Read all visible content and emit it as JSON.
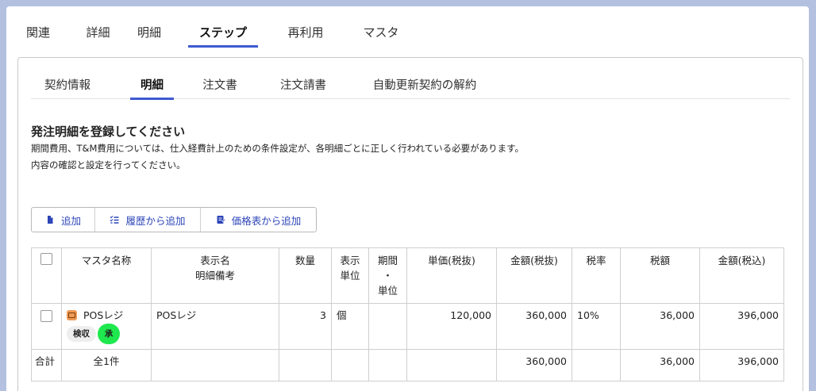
{
  "top_tabs": [
    "関連",
    "詳細",
    "明細",
    "ステップ",
    "再利用",
    "マスタ"
  ],
  "top_active": "ステップ",
  "sub_tabs": [
    "契約情報",
    "明細",
    "注文書",
    "注文請書",
    "自動更新契約の解約"
  ],
  "sub_active": "明細",
  "section": {
    "title": "発注明細を登録してください",
    "line1": "期間費用、T&M費用については、仕入経費計上のための条件設定が、各明細ごとに正しく行われている必要があります。",
    "line2": "内容の確認と設定を行ってください。"
  },
  "toolbar": {
    "add": "追加",
    "add_from_history": "履歴から追加",
    "add_from_price_list": "価格表から追加"
  },
  "table": {
    "headers": {
      "master_name": "マスタ名称",
      "display_name_1": "表示名",
      "display_name_2": "明細備考",
      "quantity": "数量",
      "unit_1": "表示",
      "unit_2": "単位",
      "period_1": "期間",
      "period_2": "・",
      "period_3": "単位",
      "unit_price": "単価(税抜)",
      "amount_ex": "金額(税抜)",
      "tax_rate": "税率",
      "tax": "税額",
      "amount_in": "金額(税込)"
    },
    "row": {
      "master_name": "POSレジ",
      "badge_inspect": "検収",
      "badge_approve": "承",
      "display_name": "POSレジ",
      "quantity": "3",
      "unit": "個",
      "period": "",
      "unit_price": "120,000",
      "amount_ex": "360,000",
      "tax_rate": "10%",
      "tax": "36,000",
      "amount_in": "396,000"
    },
    "total": {
      "label": "合計",
      "count": "全1件",
      "amount_ex": "360,000",
      "tax": "36,000",
      "amount_in": "396,000"
    }
  },
  "colors": {
    "background": "#b3c0e0",
    "accent": "#3d5ad0",
    "link": "#2d45b8",
    "master_icon": "#ef9a55",
    "approve_badge": "#1ee84d"
  }
}
